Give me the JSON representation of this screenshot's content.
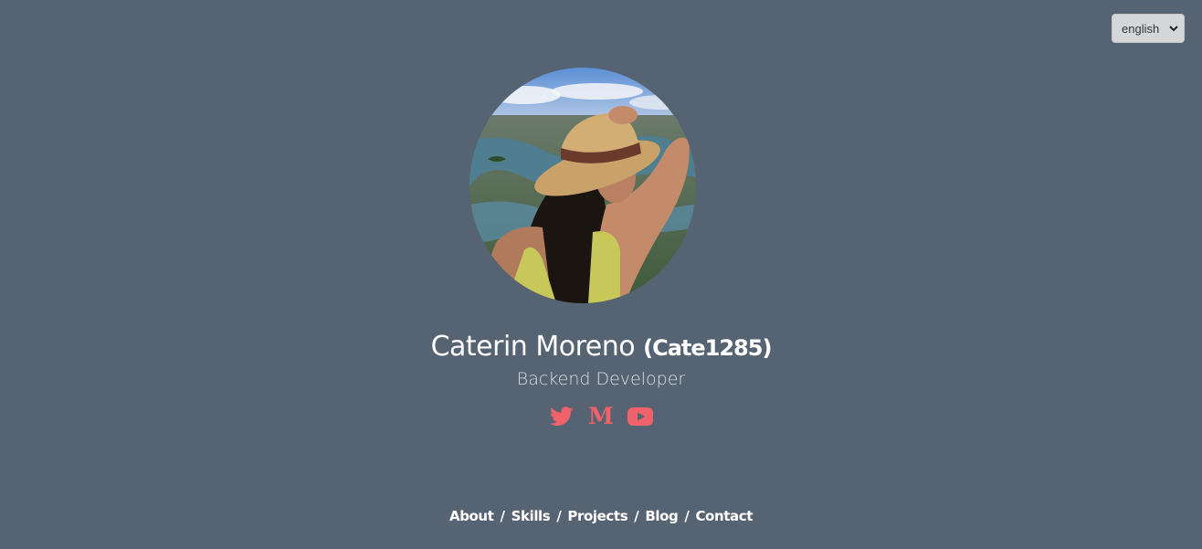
{
  "language_select": {
    "value": "english"
  },
  "profile": {
    "name": "Caterin Moreno",
    "handle": "(Cate1285)",
    "role": "Backend Developer",
    "avatar_icon": "profile-photo"
  },
  "socials": [
    {
      "name": "twitter-icon",
      "color": "#f0626a"
    },
    {
      "name": "medium-icon",
      "glyph": "M",
      "color": "#f0626a"
    },
    {
      "name": "youtube-icon",
      "color": "#f0626a"
    }
  ],
  "nav": {
    "items": [
      "About",
      "Skills",
      "Projects",
      "Blog",
      "Contact"
    ],
    "separator": "/"
  },
  "colors": {
    "background": "#566372",
    "accent": "#f0626a"
  }
}
